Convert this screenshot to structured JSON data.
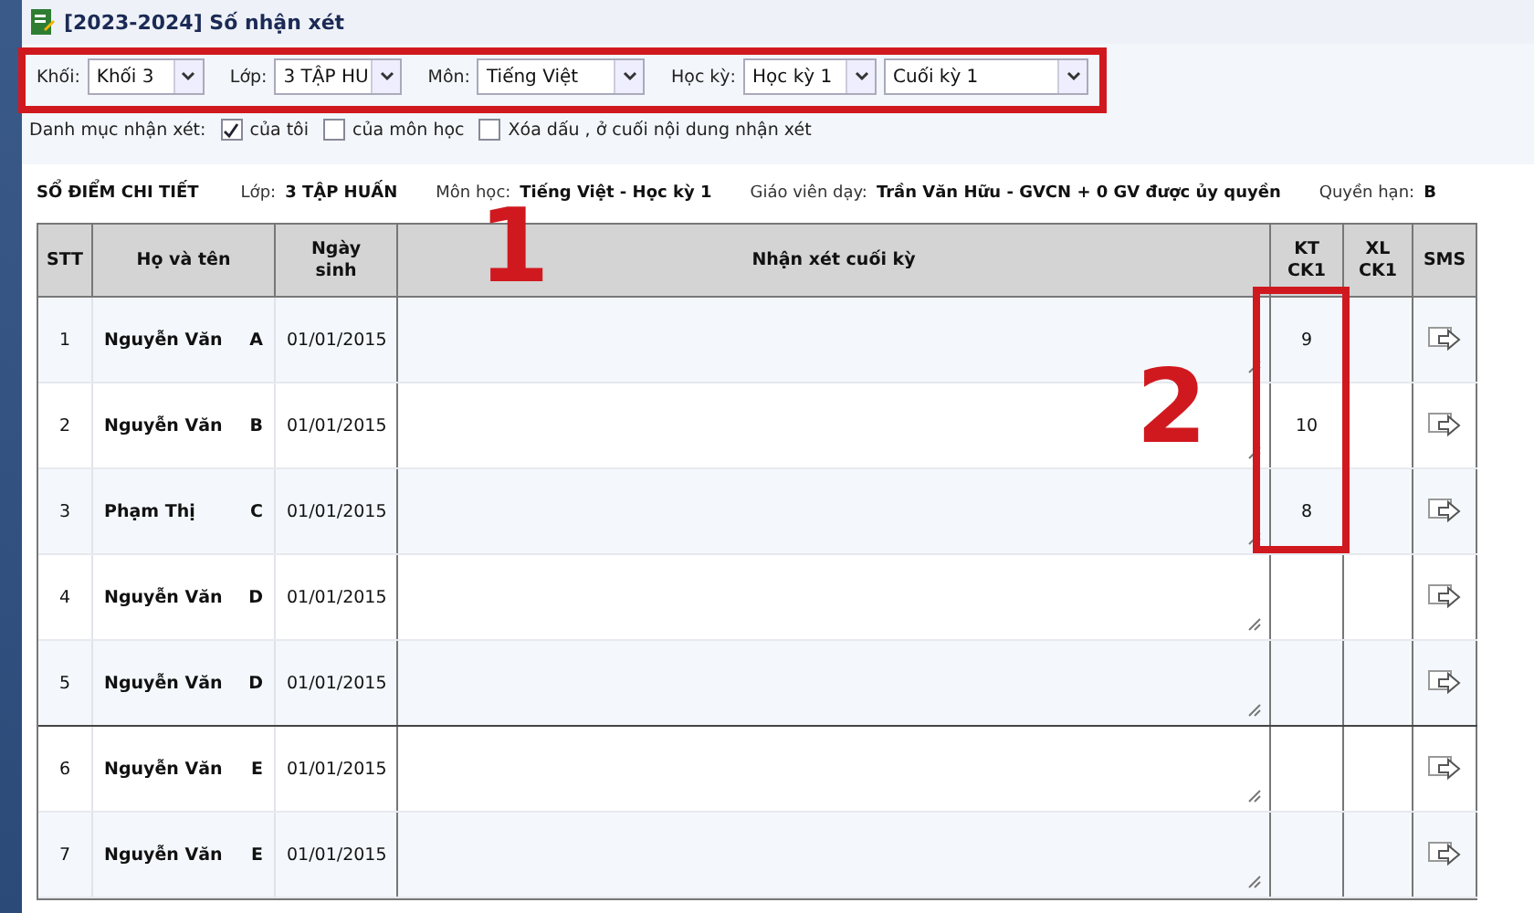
{
  "window": {
    "title": "[2023-2024] Số nhận xét"
  },
  "filters": [
    {
      "label": "Khối:",
      "value": "Khối 3"
    },
    {
      "label": "Lớp:",
      "value": "3 TẬP HU"
    },
    {
      "label": "Môn:",
      "value": "Tiếng Việt"
    },
    {
      "label": "Học kỳ:",
      "value": "Học kỳ 1"
    },
    {
      "value": "Cuối kỳ 1"
    }
  ],
  "comment_catalog": {
    "label": "Danh mục nhận xét:",
    "options": [
      {
        "label": "của tôi",
        "checked": true
      },
      {
        "label": "của môn học",
        "checked": false
      },
      {
        "label": "Xóa dấu , ở cuối nội dung nhận xét",
        "checked": false
      }
    ]
  },
  "info": {
    "title": "SỔ ĐIỂM CHI TIẾT",
    "fields": [
      {
        "label": "Lớp:",
        "value": "3 TẬP HUẤN"
      },
      {
        "label": "Môn học:",
        "value": "Tiếng Việt - Học kỳ 1"
      },
      {
        "label": "Giáo viên dạy:",
        "value": "Trần Văn Hữu - GVCN + 0 GV được ủy quyền"
      },
      {
        "label": "Quyền hạn:",
        "value": "B"
      }
    ]
  },
  "table": {
    "columns": [
      "STT",
      "Họ và tên",
      "Ngày sinh",
      "Nhận xét cuối kỳ",
      "KT CK1",
      "XL CK1",
      "SMS"
    ],
    "rows": [
      {
        "stt": "1",
        "surname": "Nguyễn Văn",
        "given_name": "A",
        "birth": "01/01/2015",
        "kt": "9",
        "separator_below": false
      },
      {
        "stt": "2",
        "surname": "Nguyễn Văn",
        "given_name": "B",
        "birth": "01/01/2015",
        "kt": "10",
        "separator_below": false
      },
      {
        "stt": "3",
        "surname": "Phạm Thị",
        "given_name": "C",
        "birth": "01/01/2015",
        "kt": "8",
        "separator_below": false
      },
      {
        "stt": "4",
        "surname": "Nguyễn Văn",
        "given_name": "D",
        "birth": "01/01/2015",
        "separator_below": false
      },
      {
        "stt": "5",
        "surname": "Nguyễn Văn",
        "given_name": "D",
        "birth": "01/01/2015",
        "separator_below": true
      },
      {
        "stt": "6",
        "surname": "Nguyễn Văn",
        "given_name": "E",
        "birth": "01/01/2015",
        "separator_below": false
      },
      {
        "stt": "7",
        "surname": "Nguyễn Văn",
        "given_name": "E",
        "birth": "01/01/2015",
        "separator_below": false
      }
    ]
  },
  "annotations": [
    "1",
    "2"
  ]
}
